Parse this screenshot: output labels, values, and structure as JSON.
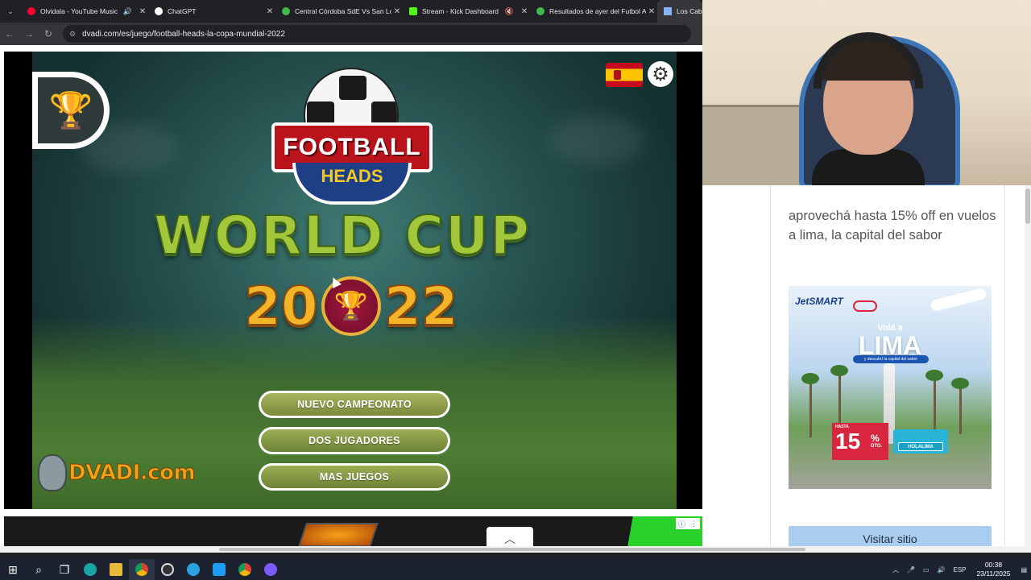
{
  "browser": {
    "tabs": [
      {
        "title": "Olvidala - YouTube Music",
        "color": "#ff0033",
        "muted": false,
        "audio": true
      },
      {
        "title": "ChatGPT",
        "color": "#ffffff",
        "audio": false
      },
      {
        "title": "Central Córdoba SdE Vs San Lo",
        "color": "#3fb950",
        "audio": false
      },
      {
        "title": "Stream - Kick Dashboard",
        "color": "#53fc18",
        "muted": true
      },
      {
        "title": "Resultados de ayer del Futbol A",
        "color": "#3fb950",
        "audio": false
      },
      {
        "title": "Los Cabe",
        "color": "#8ab4f8",
        "active": true
      }
    ],
    "url": "dvadi.com/es/juego/football-heads-la-copa-mundial-2022"
  },
  "game": {
    "logo_line1": "FOOTBALL",
    "logo_line2": "HEADS",
    "title": "WORLD CUP",
    "year_left": "20",
    "year_right": "22",
    "buttons": [
      "NUEVO CAMPEONATO",
      "DOS JUGADORES",
      "MAS JUEGOS"
    ],
    "brand": "DVADI.com",
    "trophy_icon": "trophy-icon",
    "settings_icon": "gear-icon"
  },
  "sidebar": {
    "promo_text": "aprovechá hasta 15% off en vuelos a lima, la capital del sabor",
    "ad": {
      "brand": "JetSMART",
      "headline_small": "Volá a",
      "headline": "LIMA",
      "tagline": "y descubrí la capital del sabor",
      "badge_label": "HASTA",
      "badge_value": "15",
      "badge_pct": "%",
      "badge_dto": "DTO.",
      "code": "HOLALIMA"
    },
    "visit_button": "Visitar sitio"
  },
  "taskbar": {
    "lang": "ESP",
    "time": "00:38",
    "date": "23/11/2025"
  }
}
